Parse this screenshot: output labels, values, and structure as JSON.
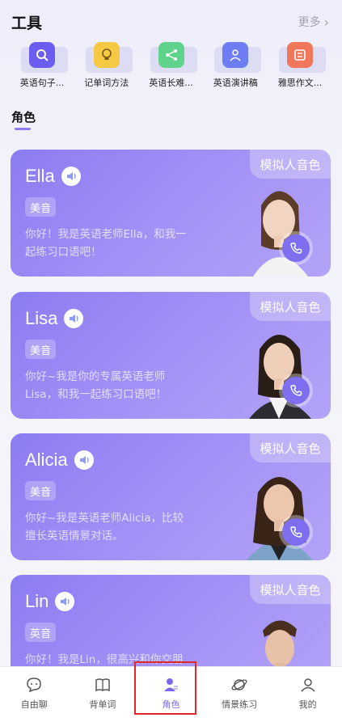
{
  "tools": {
    "title": "工具",
    "more_label": "更多",
    "items": [
      {
        "label": "英语句子...",
        "icon": "magnifier-icon",
        "color": "#6d5cf0"
      },
      {
        "label": "记单词方法",
        "icon": "lightbulb-icon",
        "color": "#f6c945"
      },
      {
        "label": "英语长难...",
        "icon": "network-icon",
        "color": "#5fd38b"
      },
      {
        "label": "英语演讲稿",
        "icon": "speaker-person-icon",
        "color": "#6f7df5"
      },
      {
        "label": "雅思作文...",
        "icon": "ielts-icon",
        "color": "#f0775a"
      }
    ]
  },
  "roles": {
    "title": "角色",
    "tag": "模拟人音色",
    "cards": [
      {
        "name": "Ella",
        "accent": "美音",
        "desc_line1": "你好！我是英语老师Ella，和我一",
        "desc_line2": "起练习口语吧！"
      },
      {
        "name": "Lisa",
        "accent": "美音",
        "desc_line1": "你好~我是你的专属英语老师",
        "desc_line2": "Lisa，和我一起练习口语吧！"
      },
      {
        "name": "Alicia",
        "accent": "美音",
        "desc_line1": "你好~我是英语老师Alicia，比较",
        "desc_line2": "擅长英语情景对话。"
      },
      {
        "name": "Lin",
        "accent": "英音",
        "desc_line1": "你好！我是Lin，很高兴和你交朋",
        "desc_line2": ""
      }
    ]
  },
  "nav": {
    "items": [
      {
        "label": "自由聊",
        "icon": "chat-bubble-icon"
      },
      {
        "label": "背单词",
        "icon": "book-icon"
      },
      {
        "label": "角色",
        "icon": "role-person-icon"
      },
      {
        "label": "情景练习",
        "icon": "planet-icon"
      },
      {
        "label": "我的",
        "icon": "user-icon"
      }
    ],
    "active_index": 2
  },
  "colors": {
    "accent": "#8b7cf6",
    "card_gradient_start": "#8c7cf3",
    "card_gradient_end": "#b3a3f7",
    "highlight_border": "#e0282c"
  }
}
